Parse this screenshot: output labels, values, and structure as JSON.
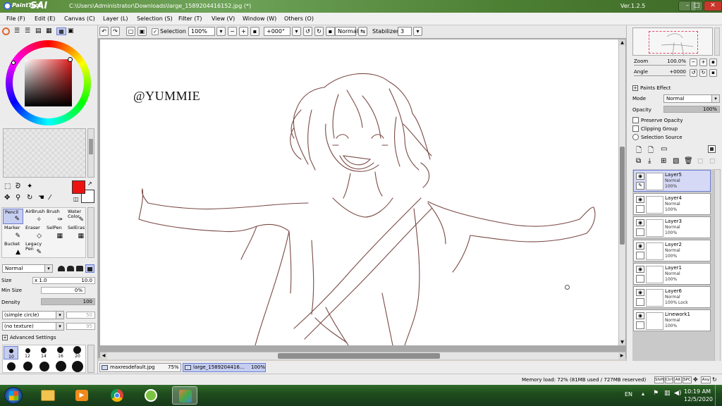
{
  "app": {
    "logo_small": "PaintTool",
    "logo_big": "SAI",
    "title_path": "C:\\Users\\Administrator\\Downloads\\large_1589204416152.jpg (*)",
    "version": "Ver.1.2.5",
    "win_min": "–",
    "win_max": "□",
    "win_close": "✕"
  },
  "menu": [
    "File (F)",
    "Edit (E)",
    "Canvas (C)",
    "Layer (L)",
    "Selection (S)",
    "Filter (T)",
    "View (V)",
    "Window (W)",
    "Others (O)"
  ],
  "toolbar": {
    "selection_check": "✓",
    "selection_label": "Selection",
    "zoom_value": "100%",
    "angle_value": "+000°",
    "blend_value": "Normal",
    "stabilizer_label": "Stabilizer",
    "stabilizer_value": "3"
  },
  "left": {
    "tools": [
      {
        "label": "Pencil",
        "icon": "✎",
        "selected": true
      },
      {
        "label": "AirBrush",
        "icon": "✧"
      },
      {
        "label": "Brush",
        "icon": "✑"
      },
      {
        "label": "Water\nColor",
        "icon": "✎"
      },
      {
        "label": "Marker",
        "icon": "✎"
      },
      {
        "label": "Eraser",
        "icon": "◇"
      },
      {
        "label": "SelPen",
        "icon": "▦"
      },
      {
        "label": "SelEras",
        "icon": "▦"
      },
      {
        "label": "Bucket",
        "icon": "▲"
      },
      {
        "label": "Legacy\nPen",
        "icon": "✎"
      }
    ],
    "blend_mode": "Normal",
    "size_label": "Size",
    "size_mult": "x 1.0",
    "size_value": "10.0",
    "minsize_label": "Min Size",
    "minsize_value": "0%",
    "density_label": "Density",
    "density_value": "100",
    "shape_value": "(simple circle)",
    "shape_num": "50",
    "texture_value": "(no texture)",
    "texture_num": "95",
    "advanced_label": "Advanced Settings",
    "brush_sizes": [
      "10",
      "12",
      "14",
      "16",
      "20"
    ],
    "primary_color": "#ee1111",
    "secondary_color": "#ffffff"
  },
  "canvas": {
    "watermark": "@YUMMIE"
  },
  "right": {
    "zoom_label": "Zoom",
    "zoom_value": "100.0%",
    "angle_label": "Angle",
    "angle_value": "+0000",
    "paints_effect_label": "Paints Effect",
    "mode_label": "Mode",
    "mode_value": "Normal",
    "opacity_label": "Opacity",
    "opacity_value": "100%",
    "preserve_opacity": "Preserve Opacity",
    "clipping_group": "Clipping Group",
    "selection_source": "Selection Source",
    "layers": [
      {
        "name": "Layer5",
        "mode": "Normal",
        "opacity": "100%",
        "selected": true
      },
      {
        "name": "Layer4",
        "mode": "Normal",
        "opacity": "100%"
      },
      {
        "name": "Layer3",
        "mode": "Normal",
        "opacity": "100%"
      },
      {
        "name": "Layer2",
        "mode": "Normal",
        "opacity": "100%"
      },
      {
        "name": "Layer1",
        "mode": "Normal",
        "opacity": "100%"
      },
      {
        "name": "Layer6",
        "mode": "Normal",
        "opacity": "100% Lock"
      },
      {
        "name": "Linework1",
        "mode": "Normal",
        "opacity": "100%"
      }
    ]
  },
  "docs": [
    {
      "name": "maxresdefault.jpg",
      "zoom": "75%"
    },
    {
      "name": "large_1589204416...",
      "zoom": "100%",
      "active": true
    }
  ],
  "status": {
    "memory": "Memory load: 72% (81MB used / 727MB reserved)",
    "keys": [
      "Shift",
      "Ctrl",
      "Alt",
      "SPC",
      "Any"
    ]
  },
  "taskbar": {
    "lang": "EN",
    "time": "10:19 AM",
    "date": "12/5/2020"
  }
}
